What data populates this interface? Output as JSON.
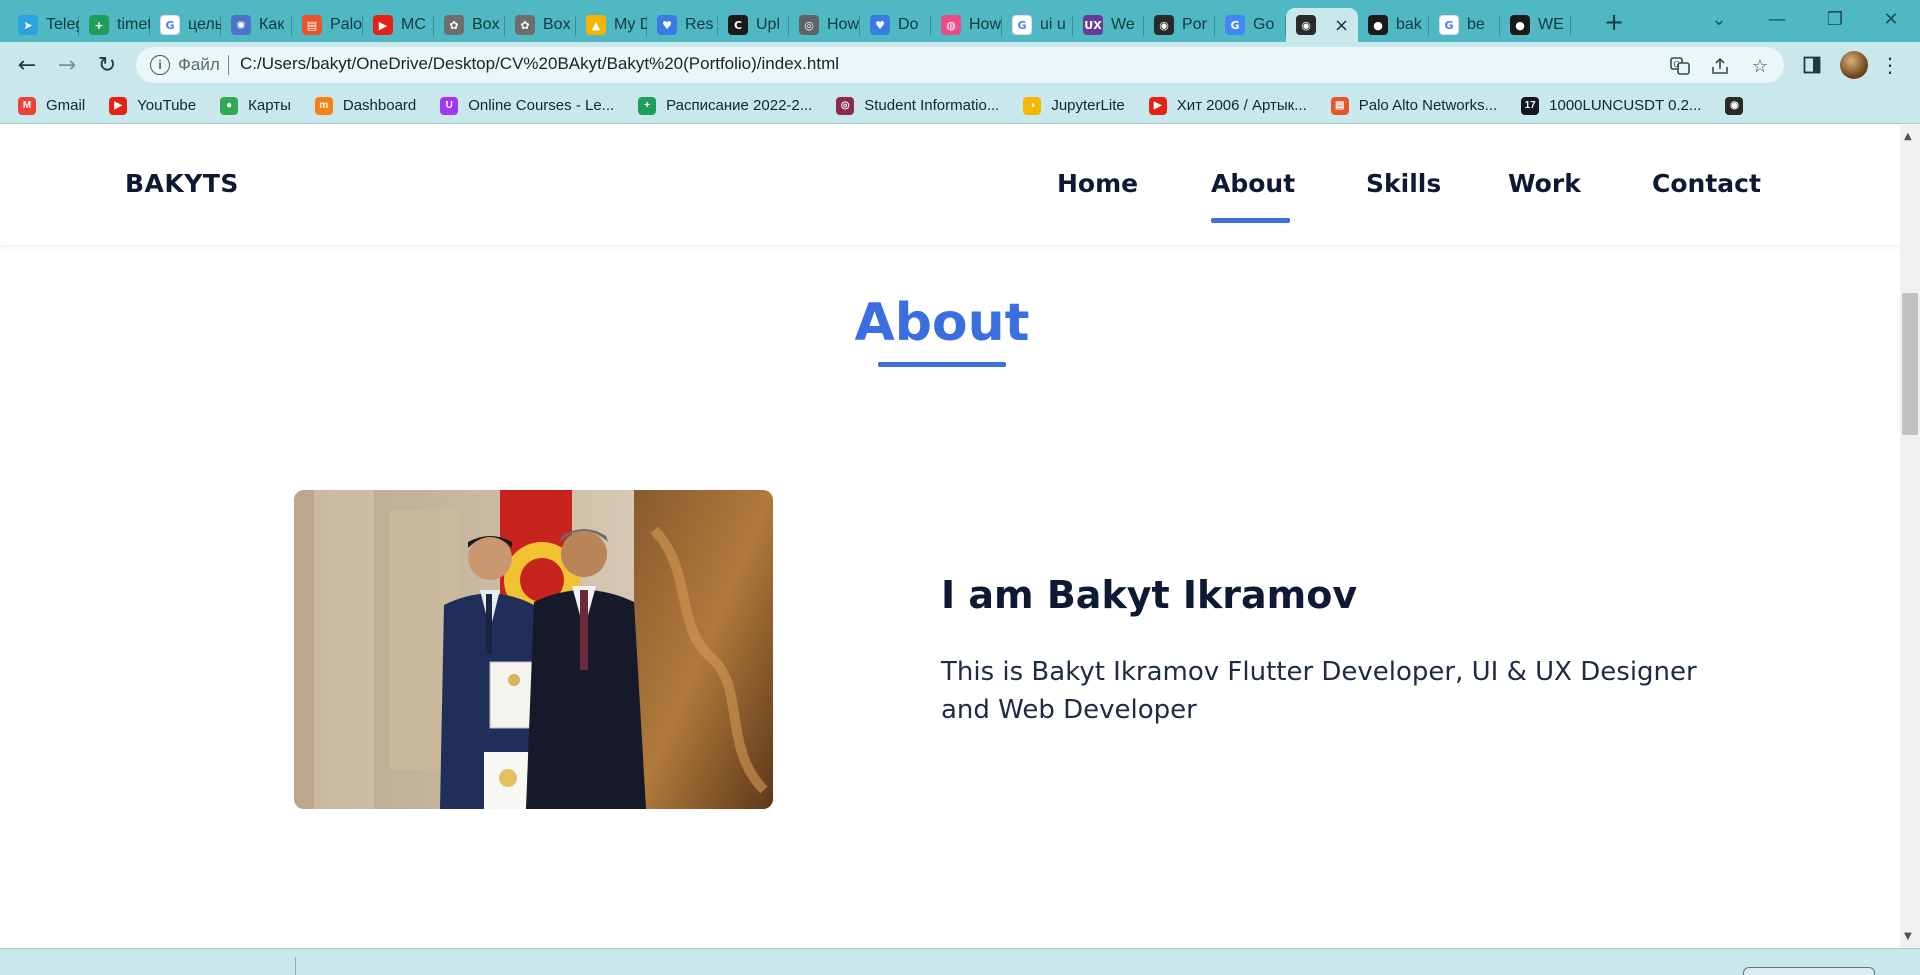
{
  "browser": {
    "tabs": [
      {
        "title": "Telegram",
        "icon": "telegram-icon",
        "color": "#2aa3df",
        "glyph": "➤"
      },
      {
        "title": "timetable",
        "icon": "sheets-icon",
        "color": "#1e9e5a",
        "glyph": "+"
      },
      {
        "title": "целые",
        "icon": "google-icon",
        "color": "#ffffff",
        "glyph": "G"
      },
      {
        "title": "Как",
        "icon": "gear-icon",
        "color": "#4a74c9",
        "glyph": "✺"
      },
      {
        "title": "Palo Alto",
        "icon": "paloalto-icon",
        "color": "#e8552b",
        "glyph": "▤"
      },
      {
        "title": "MC",
        "icon": "youtube-icon",
        "color": "#e62117",
        "glyph": "▶"
      },
      {
        "title": "Box",
        "icon": "box-icon",
        "color": "#6d6d6d",
        "glyph": "✿"
      },
      {
        "title": "Box",
        "icon": "box-icon",
        "color": "#6d6d6d",
        "glyph": "✿"
      },
      {
        "title": "My Drive",
        "icon": "drive-icon",
        "color": "#f4b400",
        "glyph": "▲"
      },
      {
        "title": "Res",
        "icon": "heart-icon",
        "color": "#3a7be0",
        "glyph": "♥"
      },
      {
        "title": "Upl",
        "icon": "codeacademy-icon",
        "color": "#1a1a1a",
        "glyph": "C"
      },
      {
        "title": "How",
        "icon": "chrome-icon",
        "color": "#5f6368",
        "glyph": "◎"
      },
      {
        "title": "Do",
        "icon": "heart-icon",
        "color": "#3a7be0",
        "glyph": "♥"
      },
      {
        "title": "How",
        "icon": "dribbble-icon",
        "color": "#ea4c89",
        "glyph": "◍"
      },
      {
        "title": "ui u",
        "icon": "google-icon",
        "color": "#ffffff",
        "glyph": "G"
      },
      {
        "title": "We",
        "icon": "ux-icon",
        "color": "#6a3a9a",
        "glyph": "UX"
      },
      {
        "title": "Por",
        "icon": "globe-icon",
        "color": "#2a2a2a",
        "glyph": "◉"
      },
      {
        "title": "Go",
        "icon": "translate-icon",
        "color": "#4285f4",
        "glyph": "G"
      },
      {
        "title": "",
        "icon": "globe-icon",
        "color": "#2a2a2a",
        "glyph": "◉",
        "active": true
      },
      {
        "title": "bak",
        "icon": "github-icon",
        "color": "#1a1a1a",
        "glyph": "●"
      },
      {
        "title": "be",
        "icon": "google-icon",
        "color": "#ffffff",
        "glyph": "G"
      },
      {
        "title": "WE",
        "icon": "github-icon",
        "color": "#1a1a1a",
        "glyph": "●"
      }
    ],
    "close_tab_glyph": "×",
    "new_tab_glyph": "+",
    "omnibox": {
      "scheme_label": "Файл",
      "url": "C:/Users/bakyt/OneDrive/Desktop/CV%20BAkyt/Bakyt%20(Portfolio)/index.html"
    },
    "bookmarks": [
      {
        "label": "Gmail",
        "icon": "gmail-icon",
        "color": "#ea4335",
        "glyph": "M"
      },
      {
        "label": "YouTube",
        "icon": "youtube-icon",
        "color": "#e62117",
        "glyph": "▶"
      },
      {
        "label": "Карты",
        "icon": "maps-icon",
        "color": "#34a853",
        "glyph": "●"
      },
      {
        "label": "Dashboard",
        "icon": "moodle-icon",
        "color": "#f98012",
        "glyph": "m"
      },
      {
        "label": "Online Courses - Le...",
        "icon": "udemy-icon",
        "color": "#a435f0",
        "glyph": "U"
      },
      {
        "label": "Расписание 2022-2...",
        "icon": "sheets-icon",
        "color": "#1e9e5a",
        "glyph": "+"
      },
      {
        "label": "Student Informatio...",
        "icon": "student-icon",
        "color": "#8a2b4a",
        "glyph": "◎"
      },
      {
        "label": "JupyterLite",
        "icon": "jupyter-icon",
        "color": "#f5b800",
        "glyph": "◑"
      },
      {
        "label": "Хит 2006 / Артык...",
        "icon": "youtube-icon",
        "color": "#e62117",
        "glyph": "▶"
      },
      {
        "label": "Palo Alto Networks...",
        "icon": "paloalto-icon",
        "color": "#e8552b",
        "glyph": "▤"
      },
      {
        "label": "1000LUNCUSDT 0.2...",
        "icon": "tradingview-icon",
        "color": "#131722",
        "glyph": "17"
      },
      {
        "label": "",
        "icon": "globe-icon",
        "color": "#2a2a2a",
        "glyph": "◉"
      }
    ]
  },
  "site": {
    "logo": "BAKYTS",
    "nav": [
      "Home",
      "About",
      "Skills",
      "Work",
      "Contact"
    ],
    "active_nav": "About",
    "accent_color": "#3b6fe0",
    "section_title": "About",
    "about": {
      "name": "I am Bakyt Ikramov",
      "description": "This is Bakyt Ikramov Flutter Developer, UI & UX Designer and Web Developer"
    }
  }
}
